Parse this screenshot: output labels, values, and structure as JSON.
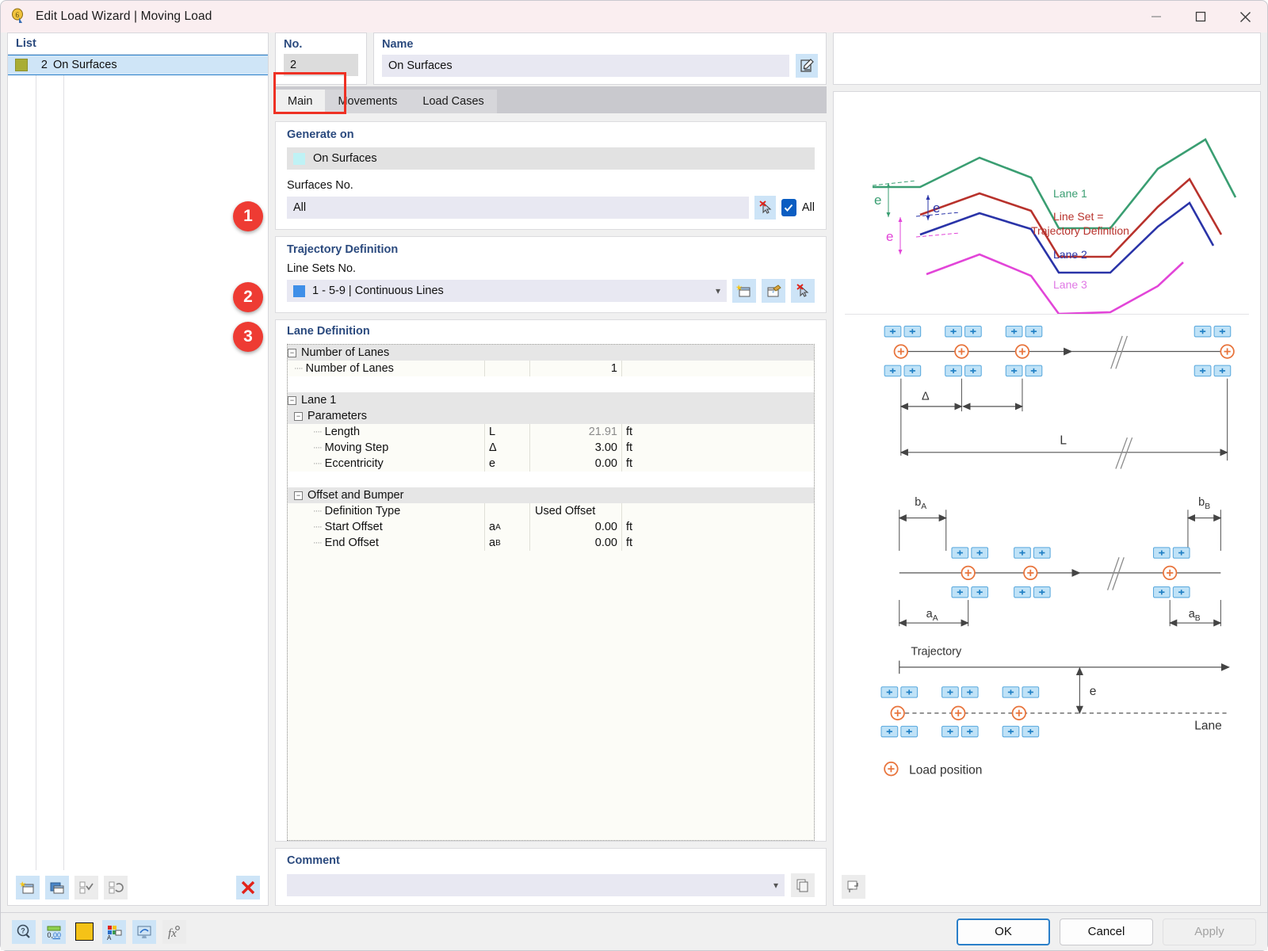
{
  "window": {
    "title": "Edit Load Wizard | Moving Load",
    "minimize_label": "Minimize",
    "maximize_label": "Maximize",
    "close_label": "Close"
  },
  "left_panel": {
    "header": "List",
    "row": {
      "no": "2",
      "name": "On Surfaces",
      "color": "#a9ad34"
    },
    "toolbar": [
      {
        "name": "new-item-button",
        "label": "New"
      },
      {
        "name": "copy-item-button",
        "label": "Copy"
      },
      {
        "name": "select-all-button",
        "label": "Select All"
      },
      {
        "name": "invert-selection-button",
        "label": "Invert Selection"
      },
      {
        "name": "delete-item-button",
        "label": "Delete"
      }
    ]
  },
  "identity": {
    "no_label": "No.",
    "no_value": "2",
    "name_label": "Name",
    "name_value": "On Surfaces",
    "edit_name_button": "Edit Name"
  },
  "tabs": [
    {
      "label": "Main",
      "active": true
    },
    {
      "label": "Movements",
      "active": false
    },
    {
      "label": "Load Cases",
      "active": false
    }
  ],
  "generate_on": {
    "title": "Generate on",
    "selected": "On Surfaces",
    "swatch_color": "#bff2f5",
    "surfaces_label": "Surfaces No.",
    "surfaces_value": "All",
    "pick_button": "Select Surfaces Graphically",
    "all_checkbox_label": "All",
    "all_checked": true
  },
  "trajectory": {
    "title": "Trajectory Definition",
    "line_sets_label": "Line Sets No.",
    "line_sets_value": "1 - 5-9 | Continuous Lines",
    "swatch_color": "#3f8fe8",
    "new_button": "New Line Set",
    "edit_button": "Edit Line Set",
    "pick_button": "Select Line Set Graphically"
  },
  "lane_definition": {
    "title": "Lane Definition",
    "rows": [
      {
        "type": "group",
        "indent": 0,
        "label": "Number of Lanes"
      },
      {
        "type": "value",
        "indent": 1,
        "label": "Number of Lanes",
        "symbol": "",
        "value": "1",
        "unit": "",
        "align": "right"
      },
      {
        "type": "blank"
      },
      {
        "type": "group",
        "indent": 0,
        "label": "Lane 1"
      },
      {
        "type": "group2",
        "indent": 1,
        "label": "Parameters"
      },
      {
        "type": "value",
        "indent": 2,
        "label": "Length",
        "symbol": "L",
        "value": "21.91",
        "unit": "ft",
        "readonly": true
      },
      {
        "type": "value",
        "indent": 2,
        "label": "Moving Step",
        "symbol": "Δ",
        "value": "3.00",
        "unit": "ft"
      },
      {
        "type": "value",
        "indent": 2,
        "label": "Eccentricity",
        "symbol": "e",
        "value": "0.00",
        "unit": "ft"
      },
      {
        "type": "blank"
      },
      {
        "type": "group2",
        "indent": 1,
        "label": "Offset and Bumper"
      },
      {
        "type": "value",
        "indent": 2,
        "label": "Definition Type",
        "symbol": "",
        "value": "Used Offset",
        "unit": "",
        "align": "left"
      },
      {
        "type": "value",
        "indent": 2,
        "label": "Start Offset",
        "symbol": "a",
        "sub": "A",
        "value": "0.00",
        "unit": "ft"
      },
      {
        "type": "value",
        "indent": 2,
        "label": "End Offset",
        "symbol": "a",
        "sub": "B",
        "value": "0.00",
        "unit": "ft"
      }
    ]
  },
  "comment": {
    "label": "Comment",
    "value": "",
    "placeholder": "",
    "copy_button": "Copy Comment",
    "extra_button": "Comment Options"
  },
  "badges": [
    "1",
    "2",
    "3"
  ],
  "figure": {
    "lanes_diagram": {
      "lane1_label": "Lane 1",
      "lane2_label": "Lane 2",
      "lane3_label": "Lane 3",
      "line_set_label_1": "Line Set =",
      "line_set_label_2": "Trajectory Definition",
      "ecc_label": "e",
      "lane1_color": "#3a9e72",
      "lane2_color": "#2a34a8",
      "lane3_color": "#e245d8",
      "trajectory_color": "#b8322c"
    },
    "step_diagram": {
      "delta_label": "Δ",
      "length_label": "L"
    },
    "offset_diagram": {
      "bA_label": "b",
      "bA_sub": "A",
      "bB_label": "b",
      "bB_sub": "B",
      "aA_label": "a",
      "aA_sub": "A",
      "aB_label": "a",
      "aB_sub": "B"
    },
    "ecc_diagram": {
      "trajectory_label": "Trajectory",
      "e_label": "e",
      "lane_label": "Lane"
    },
    "legend": {
      "load_position_label": "Load position"
    }
  },
  "bottom_toolbar": [
    {
      "name": "help-button",
      "label": "Help"
    },
    {
      "name": "units-button",
      "label": "Units and Decimal Places"
    },
    {
      "name": "color-button",
      "label": "Color"
    },
    {
      "name": "display-properties-button",
      "label": "Display Properties"
    },
    {
      "name": "visibility-button",
      "label": "Visibility"
    },
    {
      "name": "formula-button",
      "label": "Formula"
    }
  ],
  "dialog_buttons": {
    "ok": "OK",
    "cancel": "Cancel",
    "apply": "Apply"
  }
}
